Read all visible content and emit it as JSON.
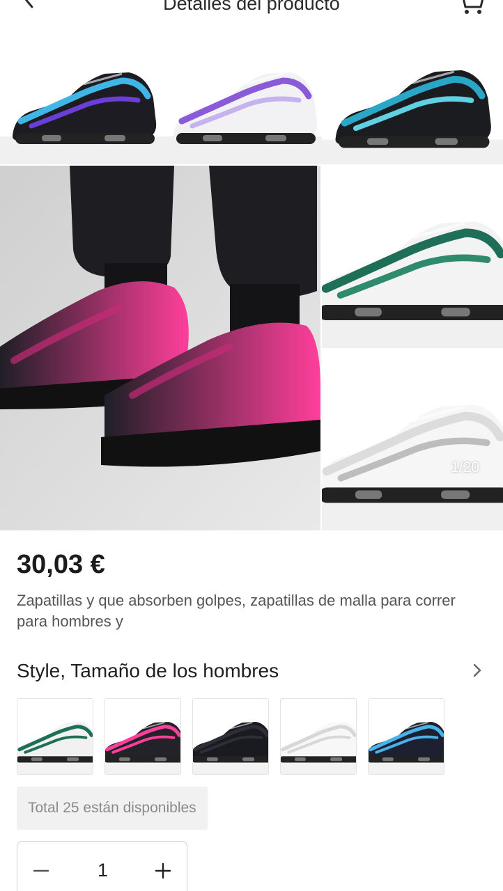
{
  "header": {
    "title": "Detalles del producto",
    "back_icon": "back-arrow-icon",
    "cart_icon": "cart-icon"
  },
  "gallery": {
    "counter": "1/20",
    "current_index": 1,
    "total_images": 20,
    "images": [
      {
        "name": "sneaker-blue-purple-gradient",
        "accent": "#3fb6e6",
        "accent2": "#6a3fd8",
        "base": "#1c1c22"
      },
      {
        "name": "sneaker-white-purple",
        "accent": "#8a5bd6",
        "accent2": "#c6b2ef",
        "base": "#f2f2f4"
      },
      {
        "name": "sneaker-black-teal",
        "accent": "#2aa7c7",
        "accent2": "#5fd1e3",
        "base": "#1a1c20"
      },
      {
        "name": "worn-sneakers-black-pink",
        "accent": "#ff3f9b",
        "accent2": "#c42b77",
        "base": "#1f1f26"
      },
      {
        "name": "sneaker-white-green",
        "accent": "#1f6e58",
        "accent2": "#2f8a6e",
        "base": "#f3f3f3"
      },
      {
        "name": "sneaker-all-white",
        "accent": "#dcdcdc",
        "accent2": "#bdbdbd",
        "base": "#f6f6f6"
      }
    ]
  },
  "product": {
    "price": "30,03 €",
    "description": "Zapatillas y que absorben golpes, zapatillas de malla para correr para hombres y"
  },
  "variants": {
    "title": "Style, Tamaño de los hombres",
    "chevron_icon": "chevron-right-icon",
    "options": [
      {
        "name": "white-green",
        "accent": "#1f6e58",
        "base": "#f1f1f1"
      },
      {
        "name": "black-pink",
        "accent": "#ff3f9b",
        "base": "#222228"
      },
      {
        "name": "all-black",
        "accent": "#2c2f38",
        "base": "#1a1b20"
      },
      {
        "name": "all-white",
        "accent": "#d7d7d7",
        "base": "#f7f7f7"
      },
      {
        "name": "black-blue",
        "accent": "#47b3ea",
        "base": "#1c2030"
      }
    ]
  },
  "stock": {
    "text": "Total 25 están disponibles"
  },
  "quantity": {
    "value": "1",
    "minus_icon": "minus-icon",
    "plus_icon": "plus-icon"
  },
  "colors": {
    "text_primary": "#1f1f1f",
    "text_secondary": "#555555",
    "stock_bg": "#f1f1f1"
  }
}
